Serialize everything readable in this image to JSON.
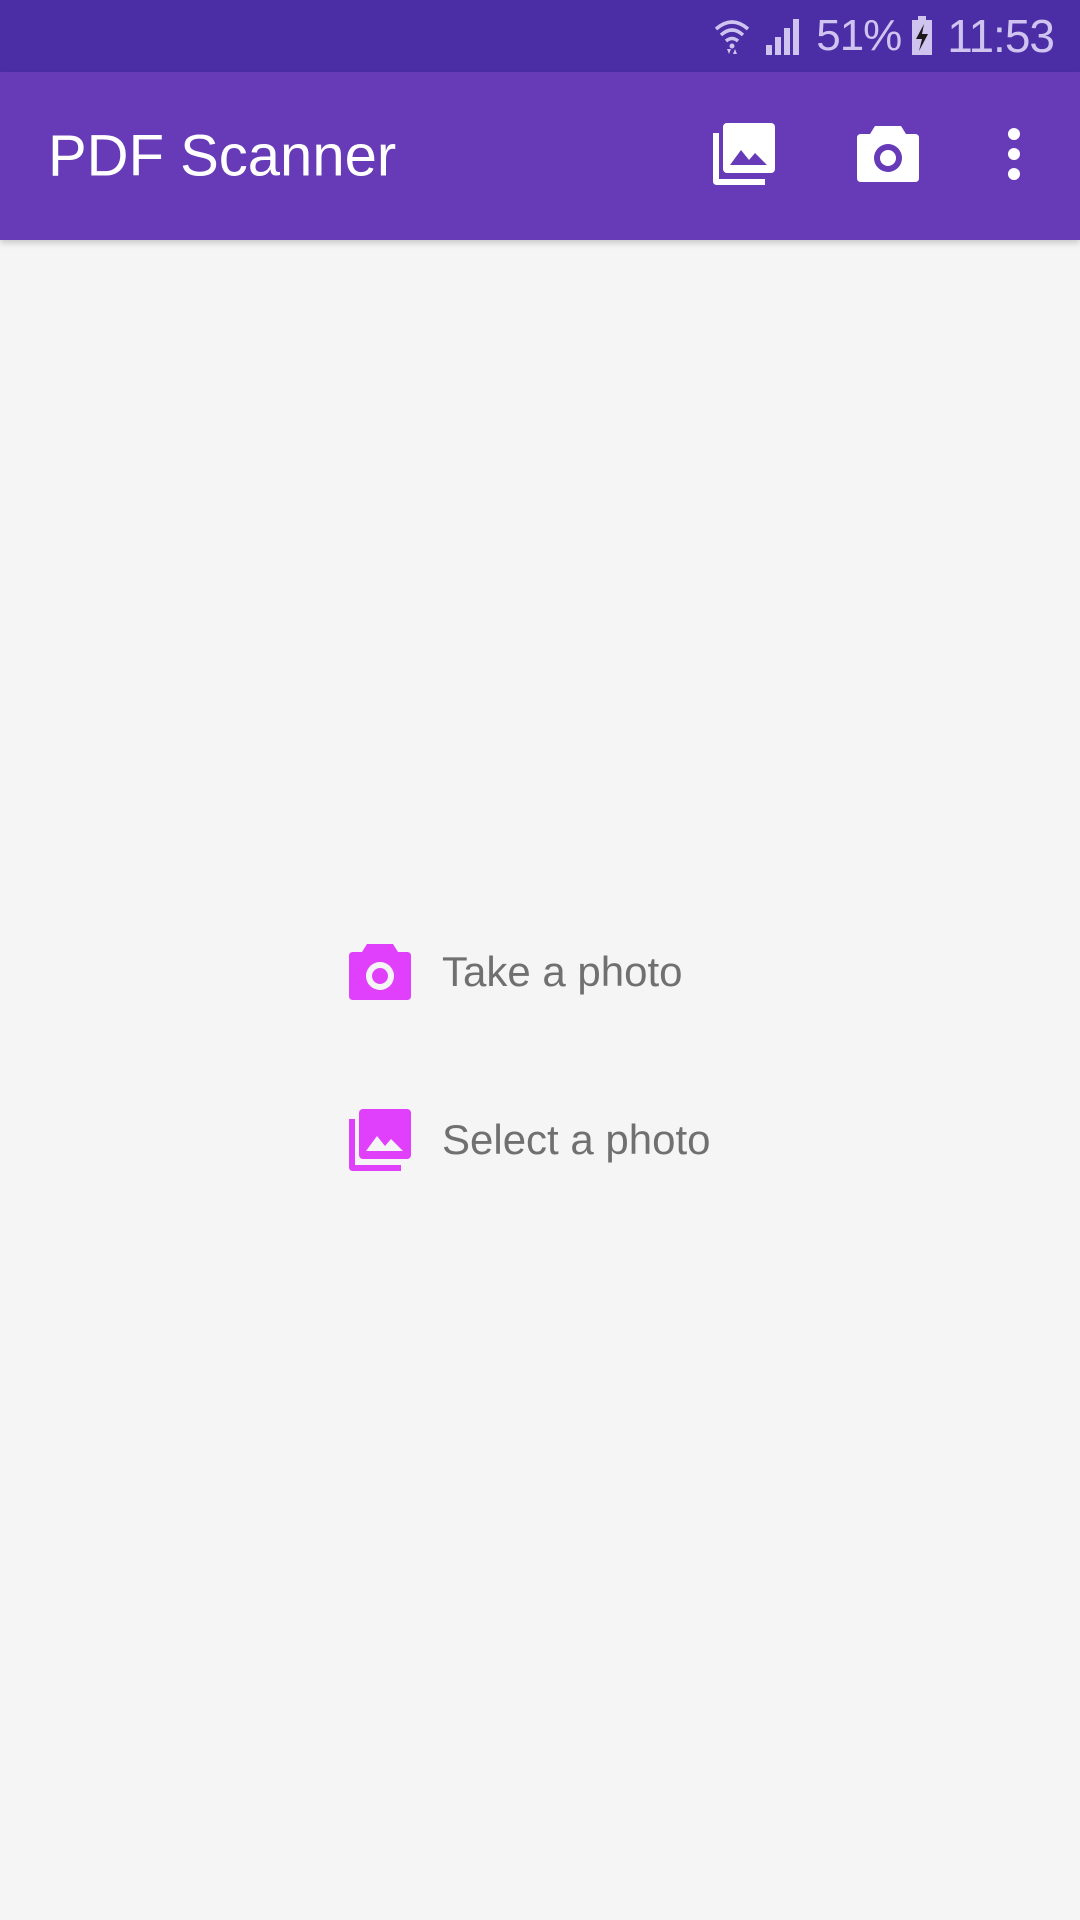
{
  "status_bar": {
    "battery_percent": "51%",
    "time": "11:53",
    "icons": [
      "wifi-icon",
      "signal-icon",
      "battery-charging-icon"
    ]
  },
  "app_bar": {
    "title": "PDF Scanner",
    "actions": [
      {
        "icon": "gallery-icon"
      },
      {
        "icon": "camera-icon"
      },
      {
        "icon": "more-vert-icon"
      }
    ]
  },
  "main": {
    "options": [
      {
        "label": "Take a photo",
        "icon": "camera-icon"
      },
      {
        "label": "Select a photo",
        "icon": "gallery-icon"
      }
    ]
  },
  "colors": {
    "status_bar": "#4b2ea6",
    "app_bar": "#673ab7",
    "accent": "#e040fb",
    "background": "#f5f5f5",
    "option_text": "#707070"
  }
}
